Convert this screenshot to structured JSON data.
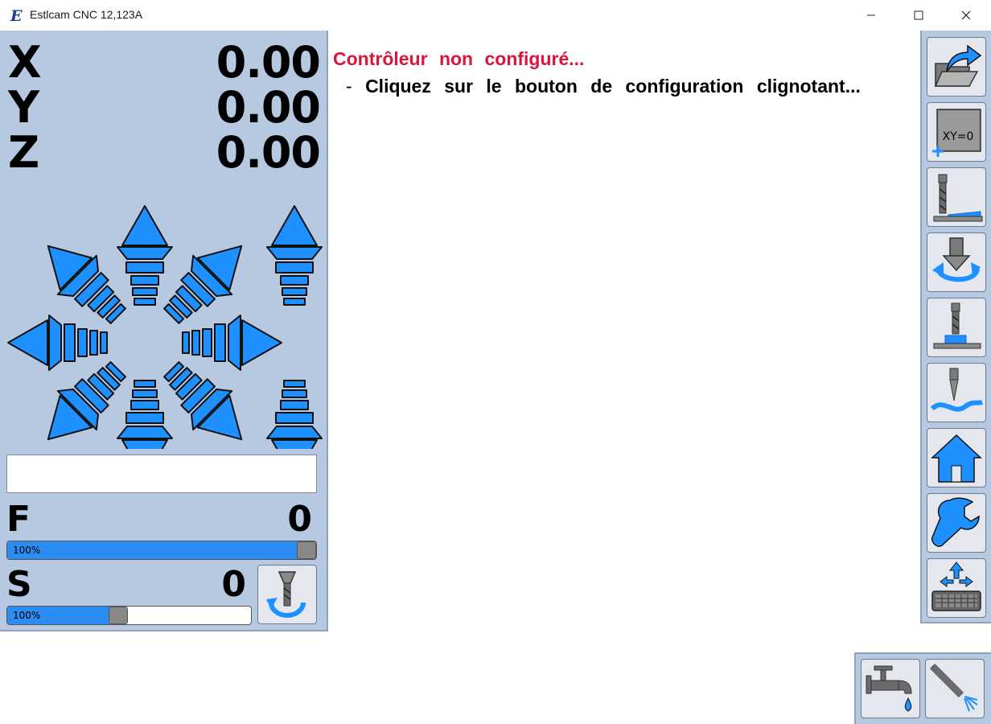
{
  "window": {
    "title": "Estlcam CNC 12,123A",
    "controls": [
      "minimize",
      "maximize",
      "close"
    ]
  },
  "dro": {
    "x": {
      "label": "X",
      "value": "0.00"
    },
    "y": {
      "label": "Y",
      "value": "0.00"
    },
    "z": {
      "label": "Z",
      "value": "0.00"
    }
  },
  "feed": {
    "label": "F",
    "value": "0",
    "override": "100%",
    "override_fraction": 1.0
  },
  "spindle": {
    "label": "S",
    "value": "0",
    "override": "100%",
    "override_fraction": 0.45
  },
  "status_box": {
    "text": ""
  },
  "message": {
    "title": "Contrôleur non configuré...",
    "dash": "-",
    "line": "Cliquez sur le bouton de configuration clignotant..."
  },
  "toolbar_icons": [
    "open-folder-icon",
    "set-zero-xy-icon",
    "tool-length-probe-icon",
    "tool-change-icon",
    "workpiece-probe-icon",
    "surface-scan-icon",
    "home-icon",
    "settings-wrench-icon",
    "keyboard-jog-icon"
  ],
  "set_zero_label": "XY=0",
  "bottom_icons": [
    "coolant-tap-icon",
    "mist-spray-icon"
  ],
  "colors": {
    "panel": "#b7c9e0",
    "accent": "#2b8cf2",
    "arrow": "#1e90ff",
    "error": "#dc143c"
  }
}
